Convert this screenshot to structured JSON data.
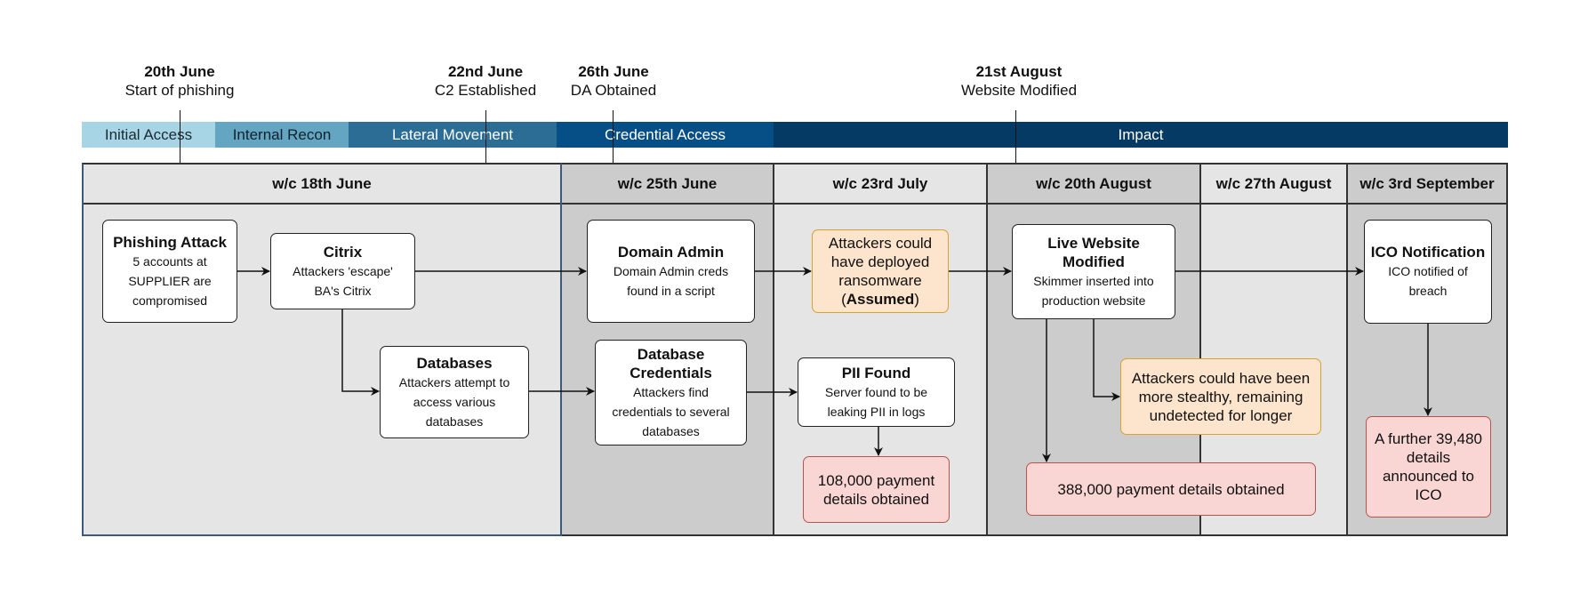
{
  "milestones": [
    {
      "date": "20th June",
      "desc": "Start of phishing"
    },
    {
      "date": "22nd June",
      "desc": "C2 Established"
    },
    {
      "date": "26th June",
      "desc": "DA Obtained"
    },
    {
      "date": "21st August",
      "desc": "Website Modified"
    }
  ],
  "phases": [
    {
      "label": "Initial Access",
      "color": "#a8d5e6",
      "text_color": "#1a2a33"
    },
    {
      "label": "Internal Recon",
      "color": "#64a5c2",
      "text_color": "#10222c"
    },
    {
      "label": "Lateral Movement",
      "color": "#2c6d95",
      "text_color": "#ffffff"
    },
    {
      "label": "Credential Access",
      "color": "#064f86",
      "text_color": "#ffffff"
    },
    {
      "label": "Impact",
      "color": "#043a64",
      "text_color": "#ffffff"
    }
  ],
  "weeks": [
    {
      "label": "w/c 18th June"
    },
    {
      "label": "w/c 25th June"
    },
    {
      "label": "w/c 23rd July"
    },
    {
      "label": "w/c 20th August"
    },
    {
      "label": "w/c 27th August"
    },
    {
      "label": "w/c 3rd September"
    }
  ],
  "nodes": {
    "phishing": {
      "title": "Phishing Attack",
      "desc": "5 accounts at SUPPLIER are compromised"
    },
    "citrix": {
      "title": "Citrix",
      "desc": "Attackers 'escape' BA's Citrix"
    },
    "databases": {
      "title": "Databases",
      "desc": "Attackers attempt to access various databases"
    },
    "domain_admin": {
      "title": "Domain Admin",
      "desc": "Domain Admin creds found in a script"
    },
    "db_credentials": {
      "title": "Database Credentials",
      "desc": "Attackers find credentials to several databases"
    },
    "ransomware": {
      "text": "Attackers could have deployed ransomware",
      "emph_open": "(",
      "emph": "Assumed",
      "emph_close": ")"
    },
    "pii_found": {
      "title": "PII Found",
      "desc": "Server found to be leaking PII in logs"
    },
    "payment_108k": {
      "text": "108,000 payment details obtained"
    },
    "live_website": {
      "title": "Live Website Modified",
      "desc": "Skimmer inserted into production website"
    },
    "stealthy": {
      "text": "Attackers could have been more stealthy, remaining undetected for longer"
    },
    "payment_388k": {
      "text": "388,000 payment details obtained"
    },
    "ico_notification": {
      "title": "ICO Notification",
      "desc": "ICO notified of breach"
    },
    "further_details": {
      "text": "A further 39,480 details announced to ICO"
    }
  },
  "colors": {
    "column_light": "#e5e5e5",
    "column_dark": "#cccccc",
    "warning_fill": "#fde4cc",
    "warning_border": "#d9a12f",
    "danger_fill": "#f9d6d3",
    "danger_border": "#b85450"
  }
}
